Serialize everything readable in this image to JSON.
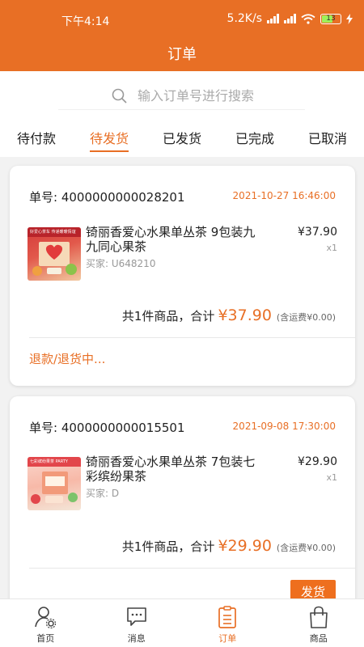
{
  "status_bar": {
    "time": "下午4:14",
    "network_speed": "5.2K/s",
    "battery": "13"
  },
  "header": {
    "title": "订单"
  },
  "search": {
    "placeholder": "输入订单号进行搜索"
  },
  "tabs": [
    {
      "label": "待付款",
      "active": false
    },
    {
      "label": "待发货",
      "active": true
    },
    {
      "label": "已发货",
      "active": false
    },
    {
      "label": "已完成",
      "active": false
    },
    {
      "label": "已取消",
      "active": false
    }
  ],
  "orders": [
    {
      "order_label": "单号: 4000000000028201",
      "date": "2021-10-27 16:46:00",
      "product_name": "锜丽香爱心水果单丛茶 9包装九九同心果茶",
      "buyer": "买家: U648210",
      "price": "¥37.90",
      "qty": "x1",
      "summary_prefix": "共1件商品，合计",
      "total": "¥37.90",
      "shipping": "(含运费¥0.00)",
      "action": "退款/退货中...",
      "thumb_text": "好爱心茶车 传递暖暖情谊"
    },
    {
      "order_label": "单号: 4000000000015501",
      "date": "2021-09-08 17:30:00",
      "product_name": "锜丽香爱心水果单丛茶 7包装七彩缤纷果茶",
      "buyer": "买家: D",
      "price": "¥29.90",
      "qty": "x1",
      "summary_prefix": "共1件商品，合计",
      "total": "¥29.90",
      "shipping": "(含运费¥0.00)",
      "action": "发货",
      "thumb_text": "七彩缤纷果茶 PARTY"
    }
  ],
  "bottom_nav": [
    {
      "label": "首页",
      "icon": "user-settings-icon",
      "active": false
    },
    {
      "label": "消息",
      "icon": "message-icon",
      "active": false
    },
    {
      "label": "订单",
      "icon": "clipboard-icon",
      "active": true
    },
    {
      "label": "商品",
      "icon": "shopping-bag-icon",
      "active": false
    }
  ],
  "colors": {
    "accent": "#e86f25",
    "background": "#f2f2f2"
  }
}
